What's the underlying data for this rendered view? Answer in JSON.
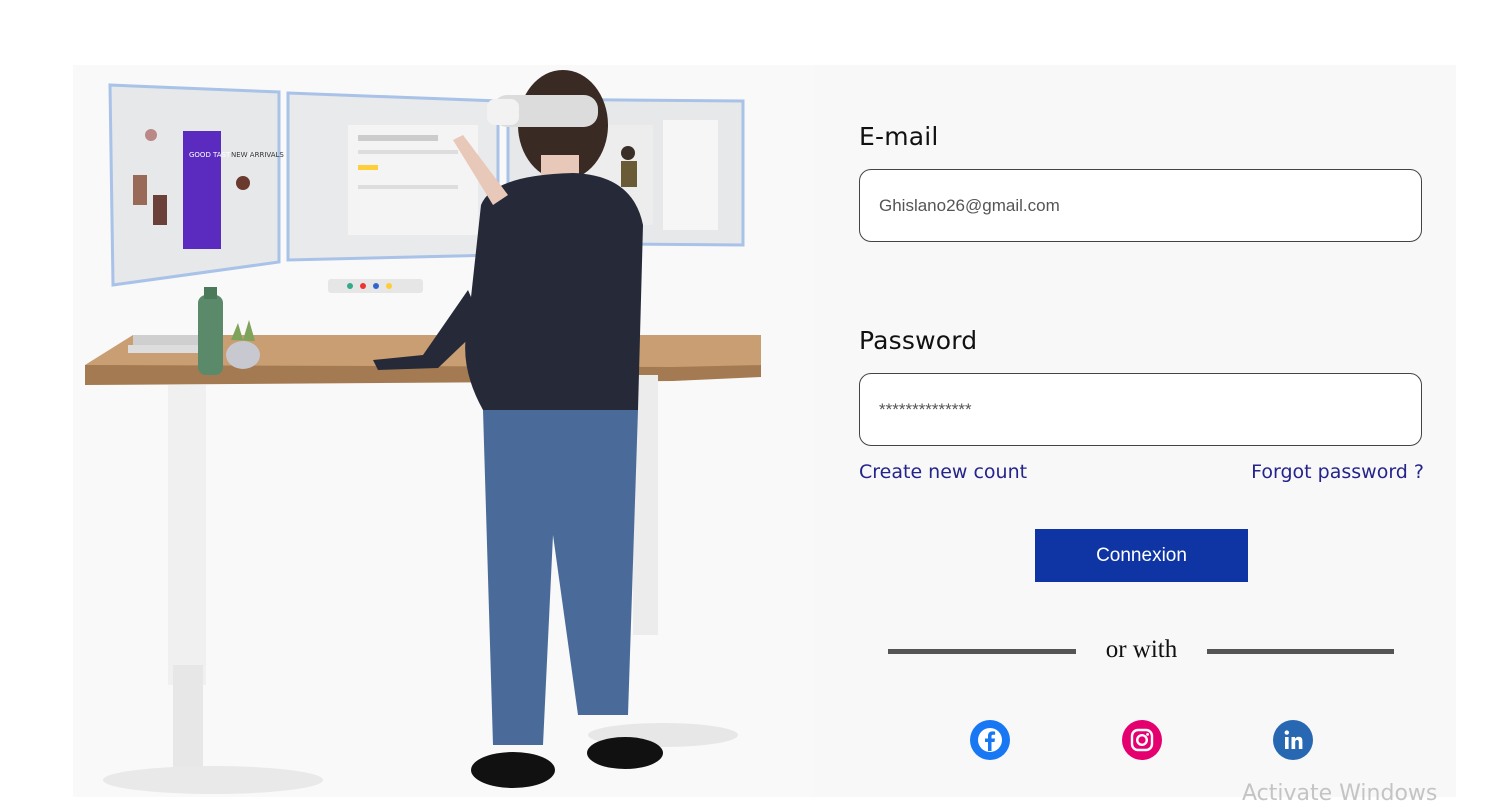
{
  "form": {
    "email_label": "E-mail",
    "email_value": "Ghislano26@gmail.com",
    "password_label": "Password",
    "password_value": "**************",
    "create_account_link": "Create new count",
    "forgot_password_link": "Forgot password ?",
    "submit_label": "Connexion",
    "separator_text": "or with"
  },
  "social": [
    {
      "name": "facebook-icon",
      "color": "#1877f2"
    },
    {
      "name": "instagram-icon",
      "color": "#e4006f"
    },
    {
      "name": "linkedin-icon",
      "color": "#2867b2"
    }
  ],
  "illustration": {
    "screen_text_1": "GOOD TASTE CLUB",
    "screen_text_2": "NEW ARRIVALS"
  },
  "watermark": "Activate Windows",
  "colors": {
    "primary_button": "#0f35a5",
    "link": "#24248a"
  }
}
